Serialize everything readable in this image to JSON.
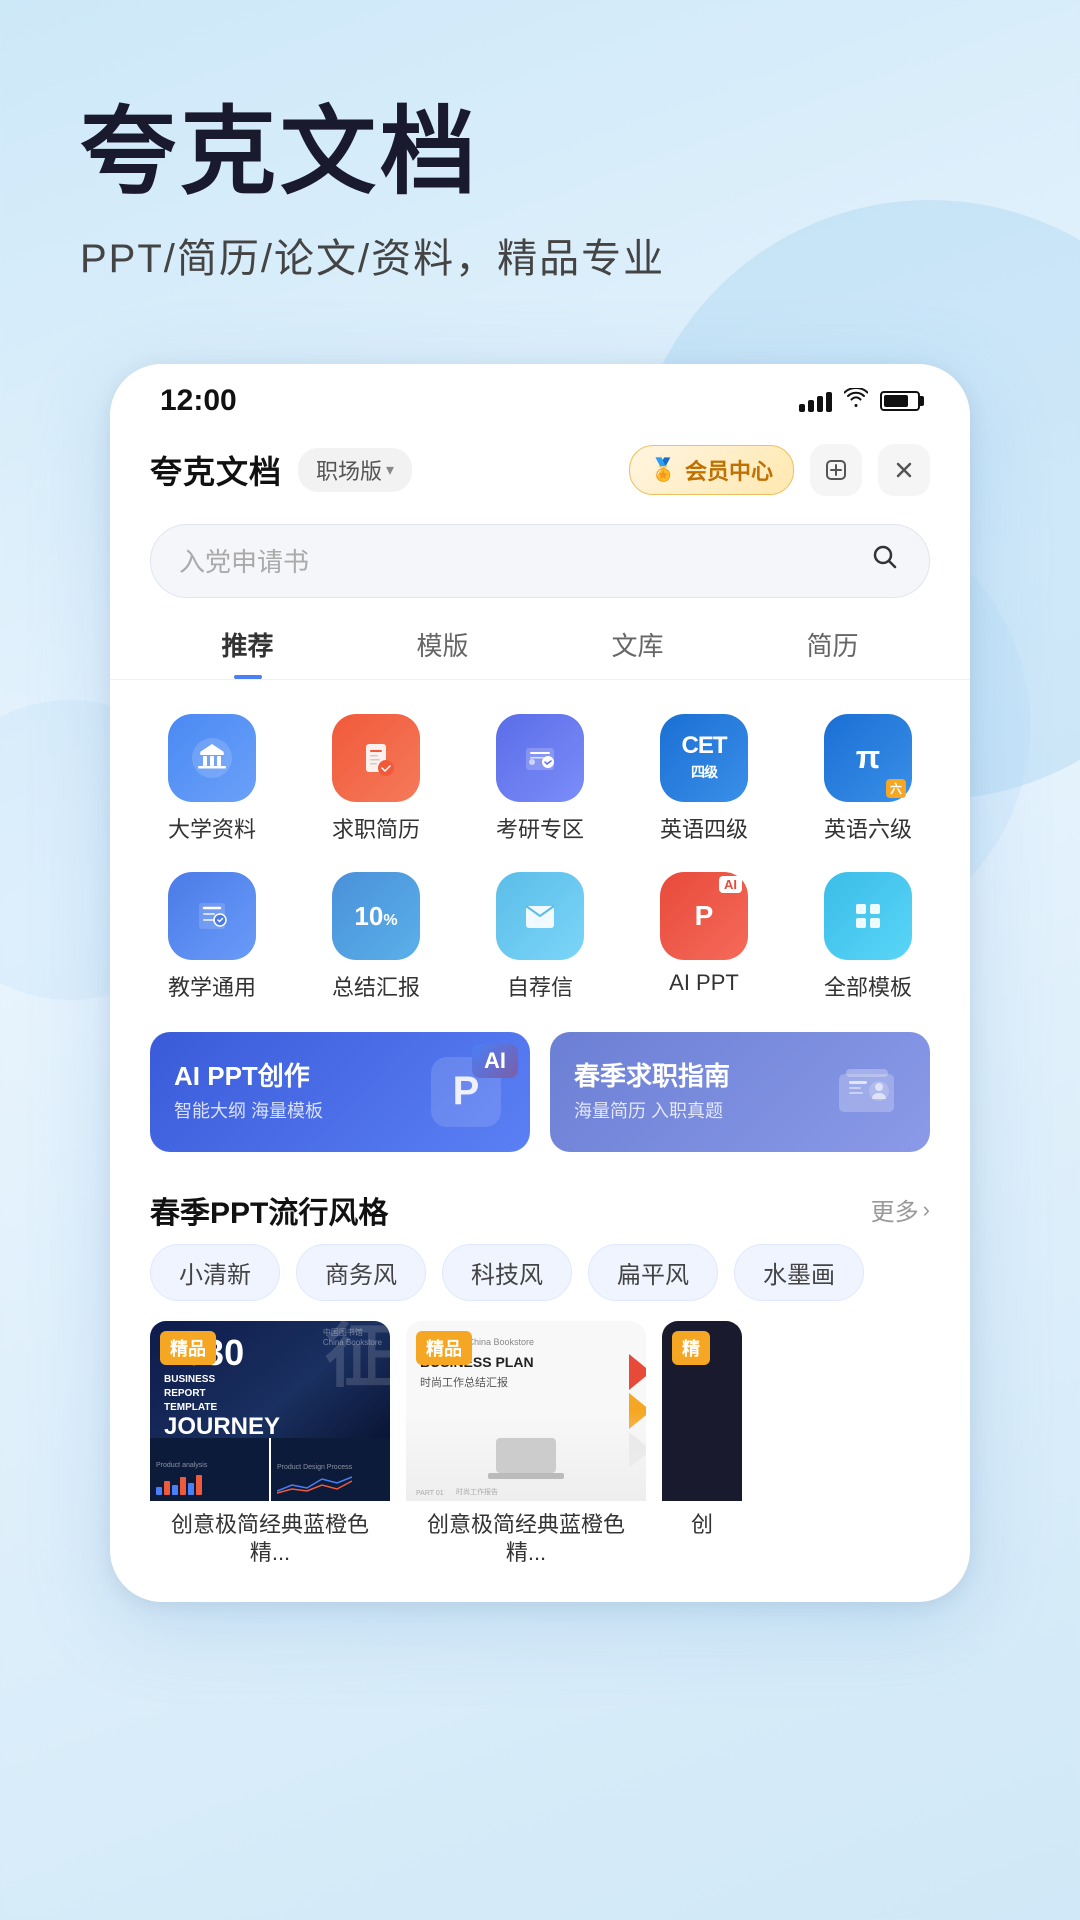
{
  "header": {
    "title": "夸克文档",
    "subtitle": "PPT/简历/论文/资料，精品专业"
  },
  "status_bar": {
    "time": "12:00",
    "signal_label": "signal",
    "wifi_label": "wifi",
    "battery_label": "battery"
  },
  "app_header": {
    "logo": "夸克文档",
    "version": "职场版",
    "vip_label": "会员中心",
    "add_label": "+"
  },
  "search": {
    "placeholder": "入党申请书"
  },
  "nav_tabs": [
    {
      "label": "推荐",
      "active": true
    },
    {
      "label": "模版",
      "active": false
    },
    {
      "label": "文库",
      "active": false
    },
    {
      "label": "简历",
      "active": false
    }
  ],
  "icon_grid": [
    {
      "icon": "📚",
      "label": "大学资料",
      "bg": "#4a7ff7"
    },
    {
      "icon": "📄",
      "label": "求职简历",
      "bg": "#f05a3a"
    },
    {
      "icon": "🎓",
      "label": "考研专区",
      "bg": "#5b7be8"
    },
    {
      "icon": "C",
      "label": "英语四级",
      "bg": "#3a7bd5",
      "text_icon": "CET"
    },
    {
      "icon": "π",
      "label": "英语六级",
      "bg": "#3a7bd5",
      "text_icon": "π"
    },
    {
      "icon": "📝",
      "label": "教学通用",
      "bg": "#5b7be8"
    },
    {
      "icon": "10%",
      "label": "总结汇报",
      "bg": "#5b9bd5",
      "text_icon": "10%"
    },
    {
      "icon": "✉️",
      "label": "自荐信",
      "bg": "#5bc4e8"
    },
    {
      "icon": "P",
      "label": "AI PPT",
      "bg": "#f05a3a",
      "text_icon": "AI P"
    },
    {
      "icon": "⊞",
      "label": "全部模板",
      "bg": "#5bc4e8"
    }
  ],
  "banners": [
    {
      "title": "AI PPT创作",
      "subtitle": "智能大纲 海量模板",
      "badge": "AI",
      "icon": "P",
      "type": "left"
    },
    {
      "title": "春季求职指南",
      "subtitle": "海量简历 入职真题",
      "icon": "👜",
      "type": "right"
    }
  ],
  "section": {
    "title": "春季PPT流行风格",
    "more_label": "更多"
  },
  "style_tags": [
    "小清新",
    "商务风",
    "科技风",
    "扁平风",
    "水墨画"
  ],
  "templates": [
    {
      "badge": "精品",
      "title": "创意极简经典蓝橙色精...",
      "type": "dark_blue",
      "year": "2030",
      "biz_text": "BUSINESS REPORT TEMPLATE",
      "journey": "JOURNEY"
    },
    {
      "badge": "精品",
      "title": "创意极简经典蓝橙色精...",
      "type": "white_arrows",
      "plan_text": "BUSINESS PLAN",
      "subtitle": "时尚工作总结汇报"
    },
    {
      "badge": "精",
      "title": "创",
      "type": "dark"
    }
  ]
}
